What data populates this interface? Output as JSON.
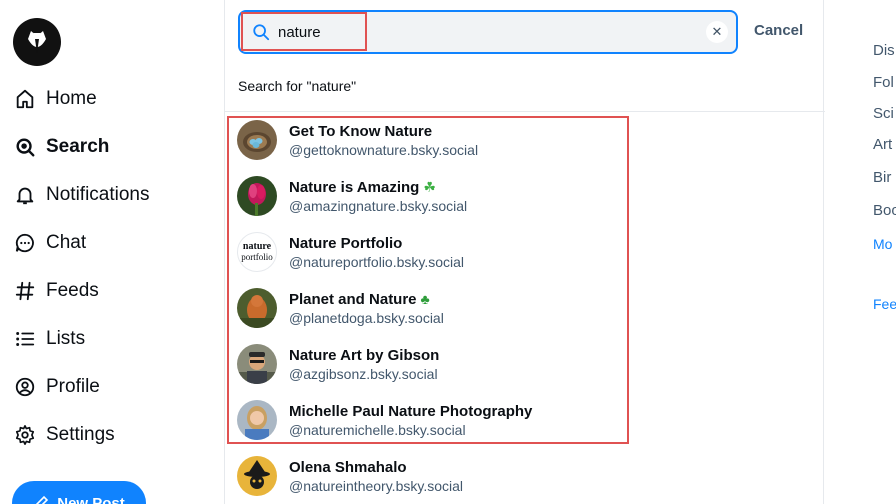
{
  "nav": {
    "items": [
      {
        "label": "Home",
        "icon": "home-icon"
      },
      {
        "label": "Search",
        "icon": "search-icon"
      },
      {
        "label": "Notifications",
        "icon": "bell-icon"
      },
      {
        "label": "Chat",
        "icon": "chat-icon"
      },
      {
        "label": "Feeds",
        "icon": "hash-icon"
      },
      {
        "label": "Lists",
        "icon": "list-icon"
      },
      {
        "label": "Profile",
        "icon": "profile-icon"
      },
      {
        "label": "Settings",
        "icon": "gear-icon"
      }
    ],
    "new_post": "New Post"
  },
  "search": {
    "query": "nature",
    "cancel": "Cancel",
    "search_for": "Search for \"nature\""
  },
  "results": [
    {
      "name": "Get To Know Nature",
      "handle": "@gettoknownature.bsky.social",
      "emoji": ""
    },
    {
      "name": "Nature is Amazing",
      "handle": "@amazingnature.bsky.social",
      "emoji": "☘"
    },
    {
      "name": "Nature Portfolio",
      "handle": "@natureportfolio.bsky.social",
      "emoji": ""
    },
    {
      "name": "Planet and Nature",
      "handle": "@planetdoga.bsky.social",
      "emoji": "♣"
    },
    {
      "name": "Nature Art by Gibson",
      "handle": "@azgibsonz.bsky.social",
      "emoji": ""
    },
    {
      "name": "Michelle Paul Nature Photography",
      "handle": "@naturemichelle.bsky.social",
      "emoji": ""
    },
    {
      "name": "Olena Shmahalo",
      "handle": "@natureintheory.bsky.social",
      "emoji": ""
    }
  ],
  "portfolio_logo": {
    "line1": "nature",
    "line2": "portfolio"
  },
  "right": {
    "links": [
      "Dis",
      "Fol",
      "Sci",
      "Art",
      "Bir",
      "Boo"
    ],
    "more": "Mo",
    "feedback": "Fee"
  },
  "colors": {
    "accent": "#1083fe",
    "highlight": "#e05252"
  }
}
